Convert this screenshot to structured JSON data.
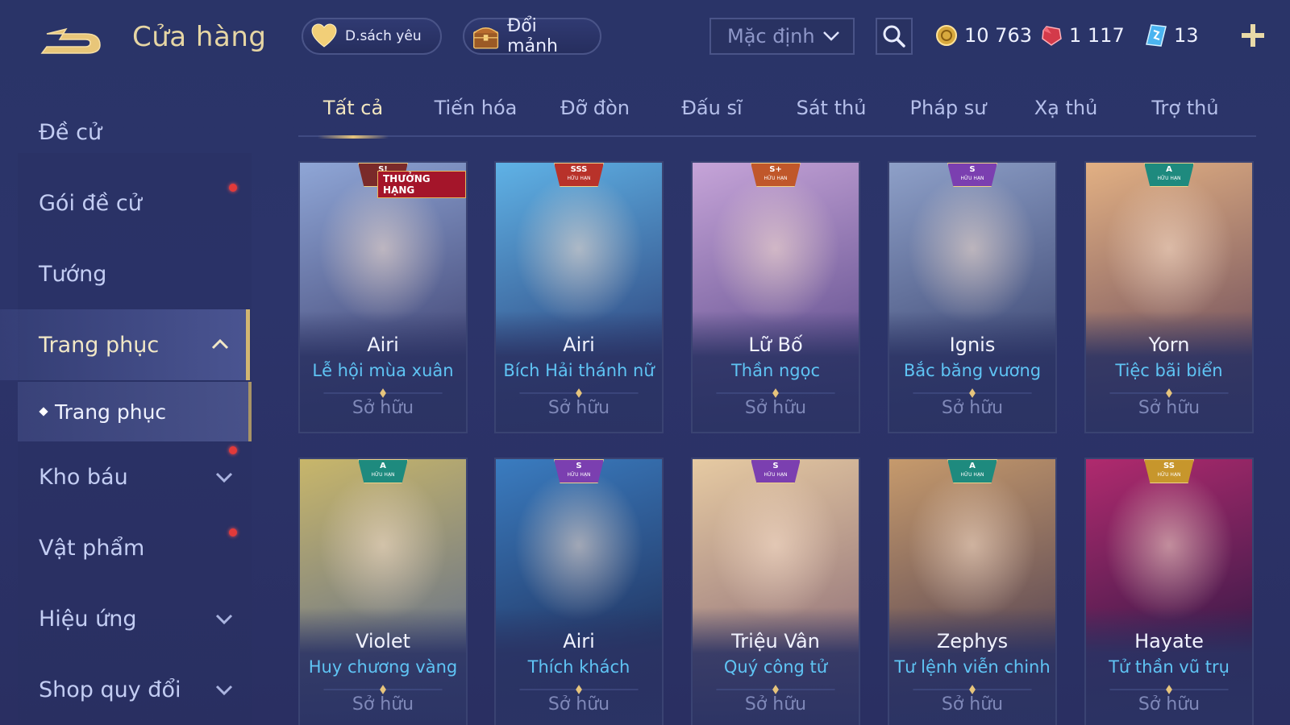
{
  "header": {
    "title": "Cửa hàng",
    "favorites_label": "D.sách yêu",
    "shard_label": "Đổi mảnh"
  },
  "sort": {
    "selected": "Mặc định"
  },
  "currency": {
    "gold": "10 763",
    "ruby": "1 117",
    "ticket": "13"
  },
  "sidebar": {
    "items": [
      {
        "label": "Đề cử"
      },
      {
        "label": "Gói đề cử"
      },
      {
        "label": "Tướng"
      },
      {
        "label": "Trang phục"
      },
      {
        "label": "Kho báu"
      },
      {
        "label": "Vật phẩm"
      },
      {
        "label": "Hiệu ứng"
      },
      {
        "label": "Shop quy đổi"
      }
    ],
    "sub_item": "Trang phục"
  },
  "tabs": [
    "Tất cả",
    "Tiến hóa",
    "Đỡ đòn",
    "Đấu sĩ",
    "Sát thủ",
    "Pháp sư",
    "Xạ thủ",
    "Trợ thủ"
  ],
  "owned_label": "Sở hữu",
  "cards": [
    {
      "hero": "Airi",
      "skin": "Lễ hội mùa xuân",
      "badge": "S!",
      "badge_sub": "",
      "rank_label": "THƯỞNG HẠNG",
      "colors": [
        "#8fa6d6",
        "#3d3f6e"
      ]
    },
    {
      "hero": "Airi",
      "skin": "Bích Hải thánh nữ",
      "badge": "SSS",
      "badge_sub": "HỮU HẠN",
      "colors": [
        "#5fb2e6",
        "#2b3d76"
      ]
    },
    {
      "hero": "Lữ Bố",
      "skin": "Thần ngọc",
      "badge": "S+",
      "badge_sub": "HỮU HẠN",
      "colors": [
        "#c6a4d8",
        "#5b4a8a"
      ]
    },
    {
      "hero": "Ignis",
      "skin": "Bắc băng vương",
      "badge": "S",
      "badge_sub": "HỮU HẠN",
      "colors": [
        "#8ea0c8",
        "#38426e"
      ]
    },
    {
      "hero": "Yorn",
      "skin": "Tiệc bãi biển",
      "badge": "A",
      "badge_sub": "HỮU HẠN",
      "colors": [
        "#e2b083",
        "#6a4a5a"
      ]
    },
    {
      "hero": "Violet",
      "skin": "Huy chương vàng",
      "badge": "A",
      "badge_sub": "HỮU HẠN",
      "colors": [
        "#c8b66a",
        "#5e6c8c"
      ]
    },
    {
      "hero": "Airi",
      "skin": "Thích khách",
      "badge": "S",
      "badge_sub": "HỮU HẠN",
      "colors": [
        "#3a7cc0",
        "#1f2c56"
      ]
    },
    {
      "hero": "Triệu Vân",
      "skin": "Quý công tử",
      "badge": "S",
      "badge_sub": "HỮU HẠN",
      "colors": [
        "#e6caa2",
        "#8a6a76"
      ]
    },
    {
      "hero": "Zephys",
      "skin": "Tư lệnh viễn chinh",
      "badge": "A",
      "badge_sub": "HỮU HẠN",
      "colors": [
        "#c69a6c",
        "#4e3e52"
      ]
    },
    {
      "hero": "Hayate",
      "skin": "Tử thần vũ trụ",
      "badge": "SS",
      "badge_sub": "HỮU HẠN",
      "colors": [
        "#b02a6e",
        "#2a1844"
      ]
    }
  ],
  "badge_colors": {
    "SSS": "#b8322a",
    "S+": "#c0572a",
    "S": "#7b3fb0",
    "A": "#1e8a7e",
    "SS": "#c7962c",
    "S!": "#7a2a2a"
  },
  "colors": {
    "accent_gold": "#e6c47c",
    "skin_blue": "#5fc4f4",
    "notification_red": "#e23a3a"
  }
}
